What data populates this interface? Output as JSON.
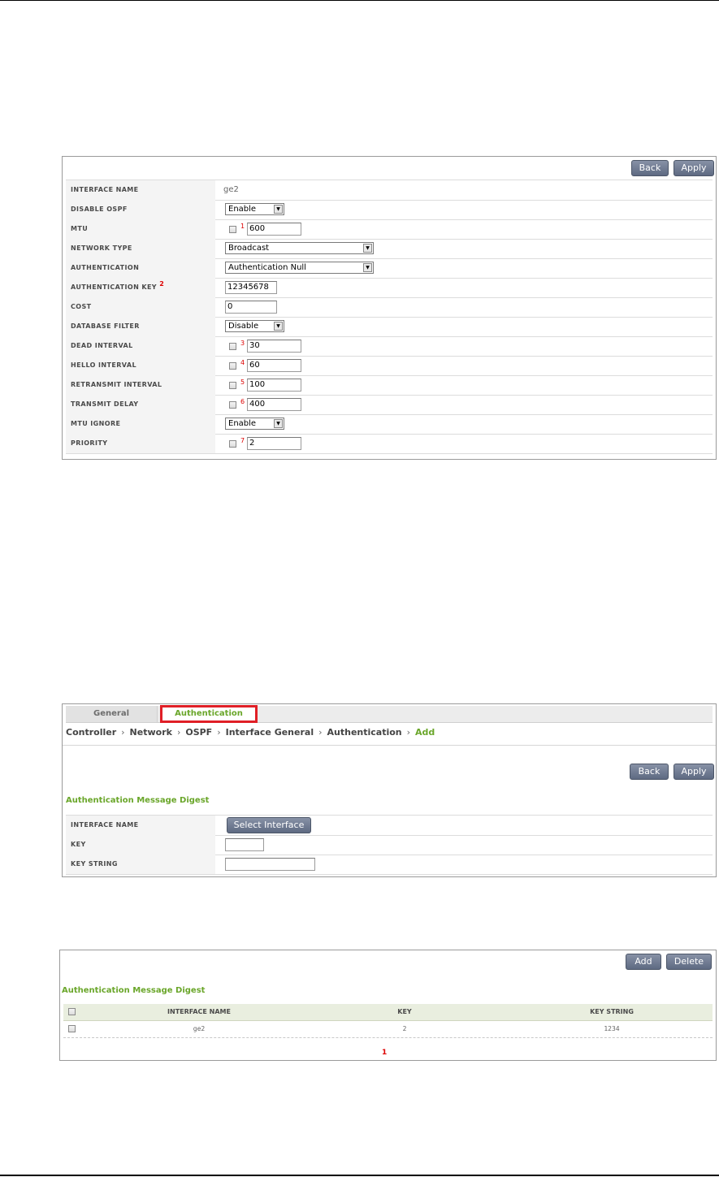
{
  "interface_form": {
    "buttons": {
      "back": "Back",
      "apply": "Apply"
    },
    "rows": {
      "interface_name": {
        "label": "INTERFACE NAME",
        "value": "ge2"
      },
      "disable_ospf": {
        "label": "DISABLE OSPF",
        "selected": "Enable"
      },
      "mtu": {
        "label": "MTU",
        "marker": "1",
        "value": "600"
      },
      "network_type": {
        "label": "NETWORK TYPE",
        "selected": "Broadcast"
      },
      "authentication": {
        "label": "AUTHENTICATION",
        "selected": "Authentication Null"
      },
      "authentication_key": {
        "label": "AUTHENTICATION KEY",
        "marker": "2",
        "value": "12345678"
      },
      "cost": {
        "label": "COST",
        "value": "0"
      },
      "database_filter": {
        "label": "DATABASE FILTER",
        "selected": "Disable"
      },
      "dead_interval": {
        "label": "DEAD INTERVAL",
        "marker": "3",
        "value": "30"
      },
      "hello_interval": {
        "label": "HELLO INTERVAL",
        "marker": "4",
        "value": "60"
      },
      "retransmit_interval": {
        "label": "RETRANSMIT INTERVAL",
        "marker": "5",
        "value": "100"
      },
      "transmit_delay": {
        "label": "TRANSMIT DELAY",
        "marker": "6",
        "value": "400"
      },
      "mtu_ignore": {
        "label": "MTU IGNORE",
        "selected": "Enable"
      },
      "priority": {
        "label": "PRIORITY",
        "marker": "7",
        "value": "2"
      }
    }
  },
  "auth_add": {
    "tabs": {
      "general": "General",
      "authentication": "Authentication"
    },
    "breadcrumb": [
      "Controller",
      "Network",
      "OSPF",
      "Interface General",
      "Authentication",
      "Add"
    ],
    "buttons": {
      "back": "Back",
      "apply": "Apply"
    },
    "section_title": "Authentication Message Digest",
    "rows": {
      "interface_name": {
        "label": "INTERFACE NAME",
        "button": "Select Interface"
      },
      "key": {
        "label": "KEY",
        "value": ""
      },
      "key_string": {
        "label": "KEY STRING",
        "value": ""
      }
    },
    "highlight_color": "#e01f26",
    "accent_color": "#6aa62a"
  },
  "auth_list": {
    "buttons": {
      "add": "Add",
      "delete": "Delete"
    },
    "section_title": "Authentication Message Digest",
    "columns": [
      "INTERFACE NAME",
      "KEY",
      "KEY STRING"
    ],
    "rows": [
      {
        "interface_name": "ge2",
        "key": "2",
        "key_string": "1234"
      }
    ],
    "pagination": "1"
  }
}
